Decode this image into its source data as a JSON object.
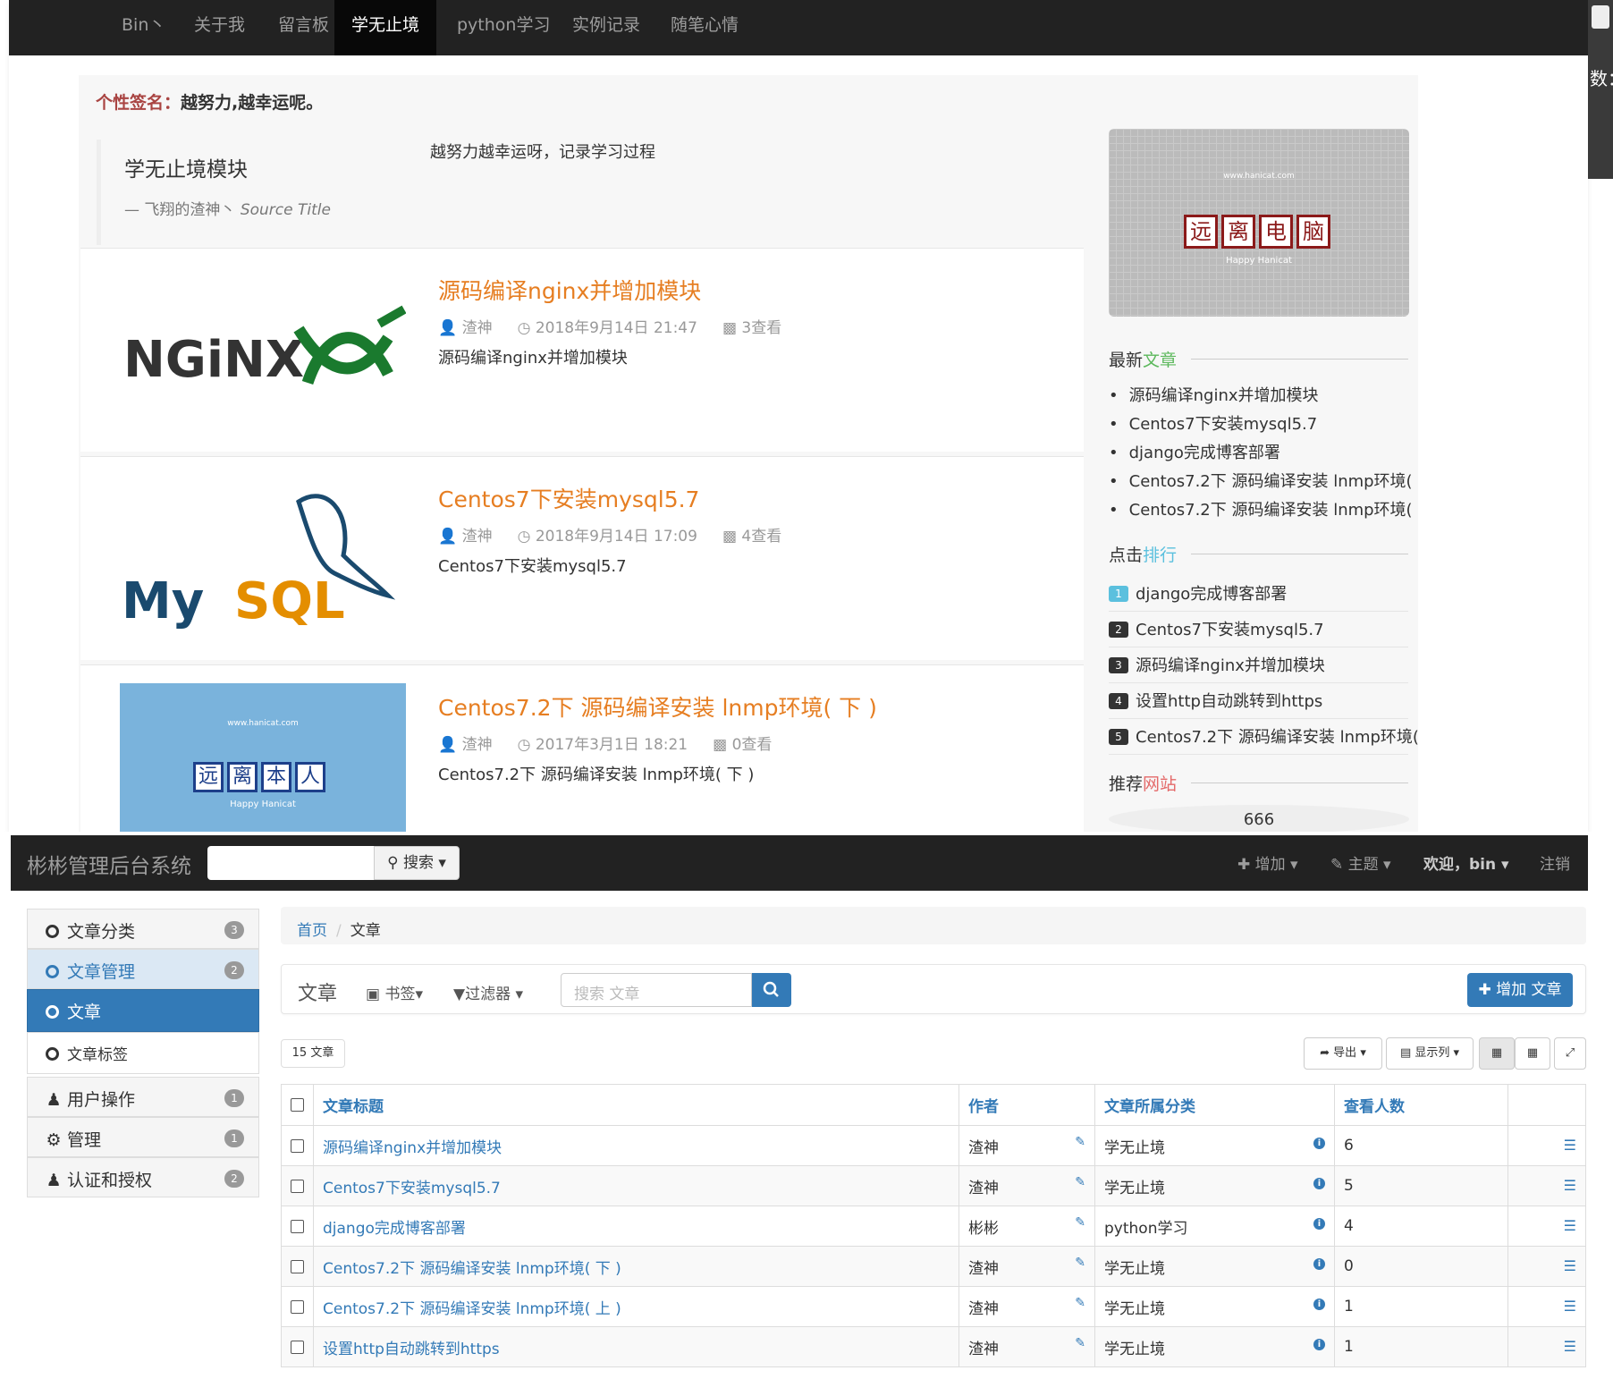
{
  "blog": {
    "nav": [
      "Bin丶",
      "关于我",
      "留言板",
      "学无止境",
      "python学习",
      "实例记录",
      "随笔心情"
    ],
    "signature_label": "个性签名：",
    "signature_text": "越努力,越幸运呢。",
    "quote": {
      "title": "学无止境模块",
      "source": "— 飞翔的渣神丶",
      "source_title": "Source Title",
      "right": "越努力越幸运呀，记录学习过程"
    },
    "posts": [
      {
        "title": "源码编译nginx并增加模块",
        "author": "渣神",
        "date": "2018年9月14日 21:47",
        "views": "3查看",
        "excerpt": "源码编译nginx并增加模块",
        "logo": "NGiNX"
      },
      {
        "title": "Centos7下安装mysql5.7",
        "author": "渣神",
        "date": "2018年9月14日 17:09",
        "views": "4查看",
        "excerpt": "Centos7下安装mysql5.7",
        "logo": "MySQL"
      },
      {
        "title": "Centos7.2下 源码编译安装 lnmp环境( 下 )",
        "author": "渣神",
        "date": "2017年3月1日 18:21",
        "views": "0查看",
        "excerpt": "Centos7.2下 源码编译安装 lnmp环境( 下 )",
        "banner_chars": [
          "远",
          "离",
          "本",
          "人"
        ],
        "banner_url": "www.hanicat.com",
        "banner_tag": "Happy Hanicat"
      }
    ],
    "side_banner": {
      "chars": [
        "远",
        "离",
        "电",
        "脑"
      ],
      "url": "www.hanicat.com",
      "tag": "Happy Hanicat"
    },
    "latest": {
      "h1": "最新",
      "h2": "文章",
      "items": [
        "源码编译nginx并增加模块",
        "Centos7下安装mysql5.7",
        "django完成博客部署",
        "Centos7.2下 源码编译安装 lnmp环境(",
        "Centos7.2下 源码编译安装 lnmp环境("
      ]
    },
    "ranking": {
      "h1": "点击",
      "h2": "排行",
      "items": [
        "django完成博客部署",
        "Centos7下安装mysql5.7",
        "源码编译nginx并增加模块",
        "设置http自动跳转到https",
        "Centos7.2下 源码编译安装 lnmp环境("
      ],
      "nums": [
        "1",
        "2",
        "3",
        "4",
        "5"
      ]
    },
    "recommend": {
      "h1": "推荐",
      "h2": "网站",
      "item": "666"
    },
    "edge_text": "数："
  },
  "admin": {
    "brand": "彬彬管理后台系统",
    "search_btn": "搜索",
    "right": {
      "add": "增加",
      "theme": "主题",
      "welcome": "欢迎，bin",
      "logout": "注销"
    },
    "menu": [
      {
        "label": "文章分类",
        "badge": "3"
      },
      {
        "label": "文章管理",
        "badge": "2"
      },
      {
        "label": "文章"
      },
      {
        "label": "文章标签"
      },
      {
        "label": "用户操作",
        "badge": "1"
      },
      {
        "label": "管理",
        "badge": "1"
      },
      {
        "label": "认证和授权",
        "badge": "2"
      }
    ],
    "breadcrumb": {
      "home": "首页",
      "current": "文章"
    },
    "panel": {
      "title": "文章",
      "bookmark": "书签",
      "filter": "过滤器",
      "search_placeholder": "搜索 文章",
      "add": "增加 文章"
    },
    "count": "15 文章",
    "tools": {
      "export": "导出",
      "columns": "显示列"
    },
    "table": {
      "headers": [
        "文章标题",
        "作者",
        "文章所属分类",
        "查看人数"
      ],
      "rows": [
        {
          "title": "源码编译nginx并增加模块",
          "author": "渣神",
          "cat": "学无止境",
          "views": "6"
        },
        {
          "title": "Centos7下安装mysql5.7",
          "author": "渣神",
          "cat": "学无止境",
          "views": "5"
        },
        {
          "title": "django完成博客部署",
          "author": "彬彬",
          "cat": "python学习",
          "views": "4"
        },
        {
          "title": "Centos7.2下 源码编译安装 lnmp环境( 下 )",
          "author": "渣神",
          "cat": "学无止境",
          "views": "0"
        },
        {
          "title": "Centos7.2下 源码编译安装 lnmp环境( 上 )",
          "author": "渣神",
          "cat": "学无止境",
          "views": "1"
        },
        {
          "title": "设置http自动跳转到https",
          "author": "渣神",
          "cat": "学无止境",
          "views": "1"
        }
      ]
    }
  },
  "colors": {
    "nav": "#222222",
    "accent": "#337ab7",
    "post_title": "#e67e22",
    "signature": "#a94442"
  }
}
